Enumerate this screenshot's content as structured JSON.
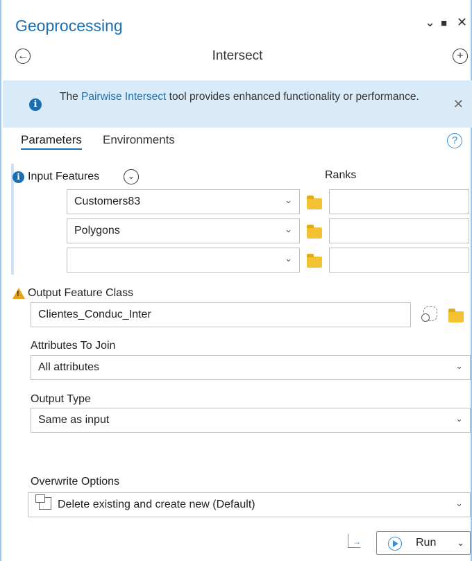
{
  "pane": {
    "title": "Geoprocessing",
    "collapse_glyph": "⌄",
    "maximize_glyph": "■",
    "close_glyph": "✕"
  },
  "nav": {
    "back_glyph": "←",
    "tool_title": "Intersect",
    "add_glyph": "+"
  },
  "banner": {
    "info_glyph": "i",
    "text_before": "The ",
    "link_text": "Pairwise Intersect",
    "text_after": " tool provides enhanced functionality or performance.",
    "close_glyph": "✕"
  },
  "tabs": {
    "parameters": "Parameters",
    "environments": "Environments",
    "help_glyph": "?"
  },
  "input_features": {
    "label": "Input Features",
    "expand_glyph": "⌄",
    "ranks_label": "Ranks",
    "rows": [
      {
        "value": "Customers83",
        "rank": ""
      },
      {
        "value": "Polygons",
        "rank": ""
      },
      {
        "value": "",
        "rank": ""
      }
    ]
  },
  "output_feature_class": {
    "label": "Output Feature Class",
    "value": "Clientes_Conduc_Inter"
  },
  "attributes_to_join": {
    "label": "Attributes To Join",
    "value": "All attributes"
  },
  "output_type": {
    "label": "Output Type",
    "value": "Same as input"
  },
  "overwrite_options": {
    "label": "Overwrite Options",
    "value": "Delete existing and create new (Default)"
  },
  "run": {
    "label": "Run"
  },
  "glyphs": {
    "chevron_down": "⌄"
  },
  "colors": {
    "accent": "#1a6fb3",
    "banner_bg": "#d9ebf9",
    "folder": "#f2c232",
    "warning": "#e8a21a"
  }
}
